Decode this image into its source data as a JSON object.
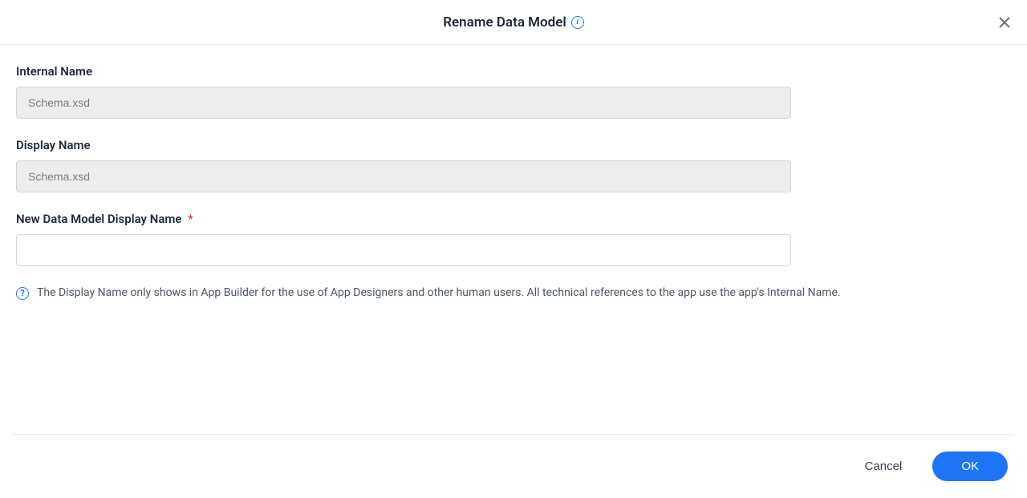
{
  "dialog": {
    "title": "Rename Data Model"
  },
  "fields": {
    "internal_name": {
      "label": "Internal Name",
      "value": "Schema.xsd"
    },
    "display_name": {
      "label": "Display Name",
      "value": "Schema.xsd"
    },
    "new_display_name": {
      "label": "New Data Model Display Name",
      "value": ""
    }
  },
  "help": {
    "text": "The Display Name only shows in App Builder for the use of App Designers and other human users. All technical references to the app use the app's Internal Name."
  },
  "footer": {
    "cancel_label": "Cancel",
    "ok_label": "OK"
  }
}
